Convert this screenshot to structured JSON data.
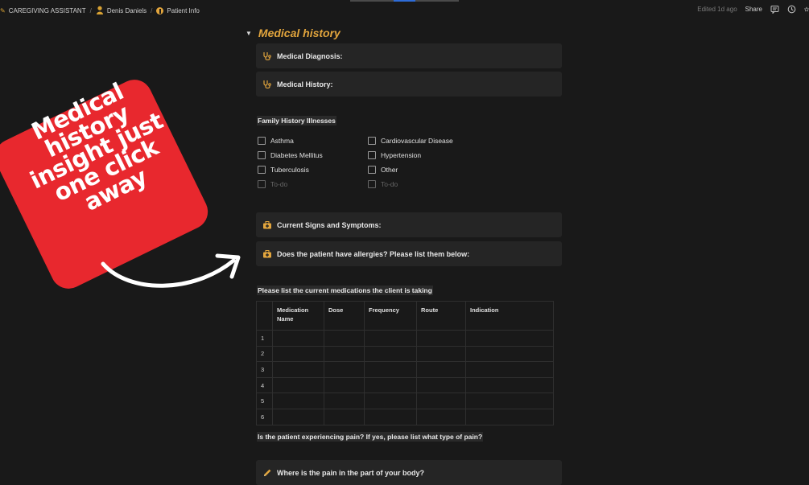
{
  "breadcrumb": {
    "items": [
      {
        "label": "CAREGIVING ASSISTANT",
        "icon": "app-icon"
      },
      {
        "label": "Denis Daniels",
        "icon": "person-icon"
      },
      {
        "label": "Patient Info",
        "icon": "info-icon"
      }
    ]
  },
  "topbar": {
    "edited": "Edited 1d ago",
    "share_label": "Share",
    "icons": [
      "comment-icon",
      "clock-icon",
      "star-icon"
    ]
  },
  "section": {
    "title": "Medical history",
    "toggle_icon": "triangle-down-icon"
  },
  "callouts": {
    "diagnosis": {
      "label": "Medical Diagnosis:",
      "icon": "stethoscope-icon"
    },
    "history": {
      "label": "Medical History:",
      "icon": "stethoscope-icon"
    },
    "symptoms": {
      "label": "Current Signs and Symptoms:",
      "icon": "first-aid-kit-icon"
    },
    "allergies": {
      "label": "Does the patient have allergies? Please list them below:",
      "icon": "first-aid-kit-icon"
    },
    "pain_location": {
      "label": "Where is the pain in the part of your body?",
      "icon": "pencil-icon"
    }
  },
  "family_history": {
    "label": "Family History Illnesses",
    "left": [
      "Asthma",
      "Diabetes Mellitus",
      "Tuberculosis"
    ],
    "right": [
      "Cardiovascular Disease",
      "Hypertension",
      "Other"
    ],
    "placeholder": "To-do"
  },
  "medications": {
    "label": "Please list the current medications the client is taking",
    "headers": [
      "Medication Name",
      "Dose",
      "Frequency",
      "Route",
      "Indication"
    ],
    "rows": [
      "1",
      "2",
      "3",
      "4",
      "5",
      "6"
    ]
  },
  "pain": {
    "label": "Is the patient experiencing pain? If yes, please list what type of pain?"
  },
  "promo": {
    "text": "Medical history insight just one click away",
    "color": "#e8282e"
  },
  "colors": {
    "accent": "#e2a53d",
    "background": "#191919",
    "callout_bg": "#252525"
  }
}
